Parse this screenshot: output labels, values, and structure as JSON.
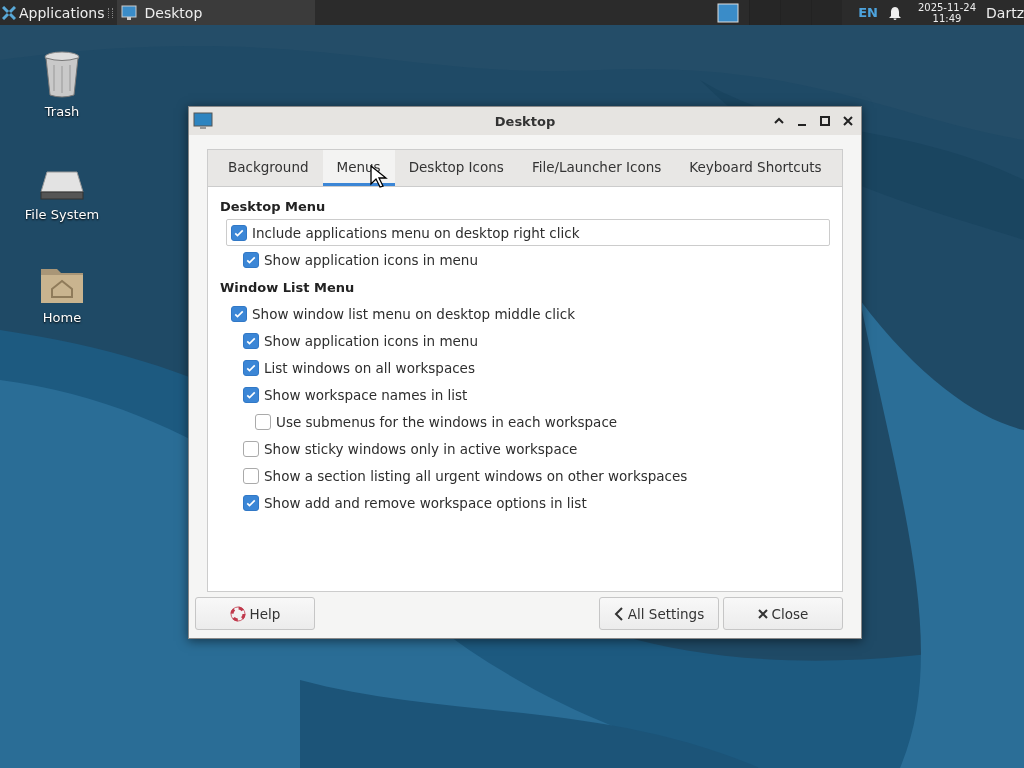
{
  "panel": {
    "apps_label": "Applications",
    "tasks": [
      {
        "title": "Desktop",
        "selected": true
      }
    ],
    "keyboard_layout": "EN",
    "date": "2025-11-24",
    "time": "11:49",
    "user": "Dartz"
  },
  "desktop_icons": [
    {
      "kind": "trash",
      "label": "Trash"
    },
    {
      "kind": "drive",
      "label": "File System"
    },
    {
      "kind": "home",
      "label": "Home"
    }
  ],
  "window": {
    "title": "Desktop",
    "tabs": [
      {
        "label": "Background",
        "selected": false
      },
      {
        "label": "Menus",
        "selected": true
      },
      {
        "label": "Desktop Icons",
        "selected": false
      },
      {
        "label": "File/Launcher Icons",
        "selected": false
      },
      {
        "label": "Keyboard Shortcuts",
        "selected": false
      }
    ],
    "sections": [
      {
        "heading": "Desktop Menu",
        "options": [
          {
            "label": "Include applications menu on desktop right click",
            "checked": true,
            "focused": true,
            "children": [
              {
                "label": "Show application icons in menu",
                "checked": true,
                "focused": false
              }
            ]
          }
        ]
      },
      {
        "heading": "Window List Menu",
        "options": [
          {
            "label": "Show window list menu on desktop middle click",
            "checked": true,
            "focused": false,
            "children": [
              {
                "label": "Show application icons in menu",
                "checked": true,
                "focused": false
              },
              {
                "label": "List windows on all workspaces",
                "checked": true,
                "focused": false
              },
              {
                "label": "Show workspace names in list",
                "checked": true,
                "focused": false,
                "children": [
                  {
                    "label": "Use submenus for the windows in each workspace",
                    "checked": false,
                    "focused": false
                  }
                ]
              },
              {
                "label": "Show sticky windows only in active workspace",
                "checked": false,
                "focused": false
              },
              {
                "label": "Show a section listing all urgent windows on other workspaces",
                "checked": false,
                "focused": false
              },
              {
                "label": "Show add and remove workspace options in list",
                "checked": true,
                "focused": false
              }
            ]
          }
        ]
      }
    ],
    "buttons": [
      {
        "kind": "help",
        "label": "Help"
      },
      {
        "kind": "back",
        "label": "All Settings"
      },
      {
        "kind": "close",
        "label": "Close"
      }
    ]
  }
}
